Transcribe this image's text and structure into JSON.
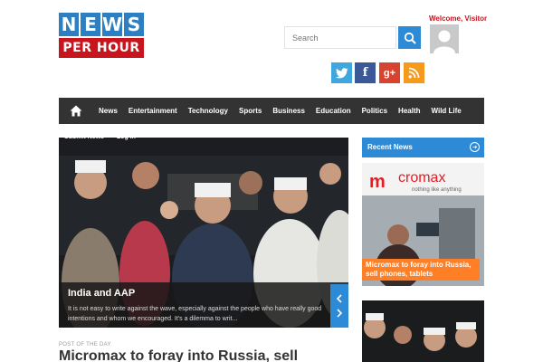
{
  "logo": {
    "letters": [
      "N",
      "E",
      "W",
      "S"
    ],
    "tagline": "PER HOUR"
  },
  "search": {
    "placeholder": "Search"
  },
  "user": {
    "welcome": "Welcome, Visitor"
  },
  "social": [
    "twitter-icon",
    "facebook-icon",
    "googleplus-icon",
    "rss-icon"
  ],
  "nav": {
    "items": [
      "News",
      "Entertainment",
      "Technology",
      "Sports",
      "Business",
      "Education",
      "Politics",
      "Health",
      "Wild Life"
    ]
  },
  "sub_links": [
    "Submit News",
    "Log In"
  ],
  "slider": {
    "title": "India and AAP",
    "excerpt": "It is not easy to write against the wave, especially against the people who have really good intentions and whom we encouraged. It's a dilemma to writ..."
  },
  "post_of_day": {
    "label": "POST OF THE DAY",
    "title": "Micromax to foray into Russia, sell"
  },
  "sidebar": {
    "recent_label": "Recent News",
    "card1": {
      "title": "Micromax to foray into Russia, sell phones, tablets",
      "brand": "cromax",
      "slogan": "nothing like anything"
    }
  },
  "colors": {
    "accent": "#2d8ad6",
    "brand_red": "#c8141c",
    "nav_bg": "#333333",
    "orange": "#ff7f27"
  }
}
